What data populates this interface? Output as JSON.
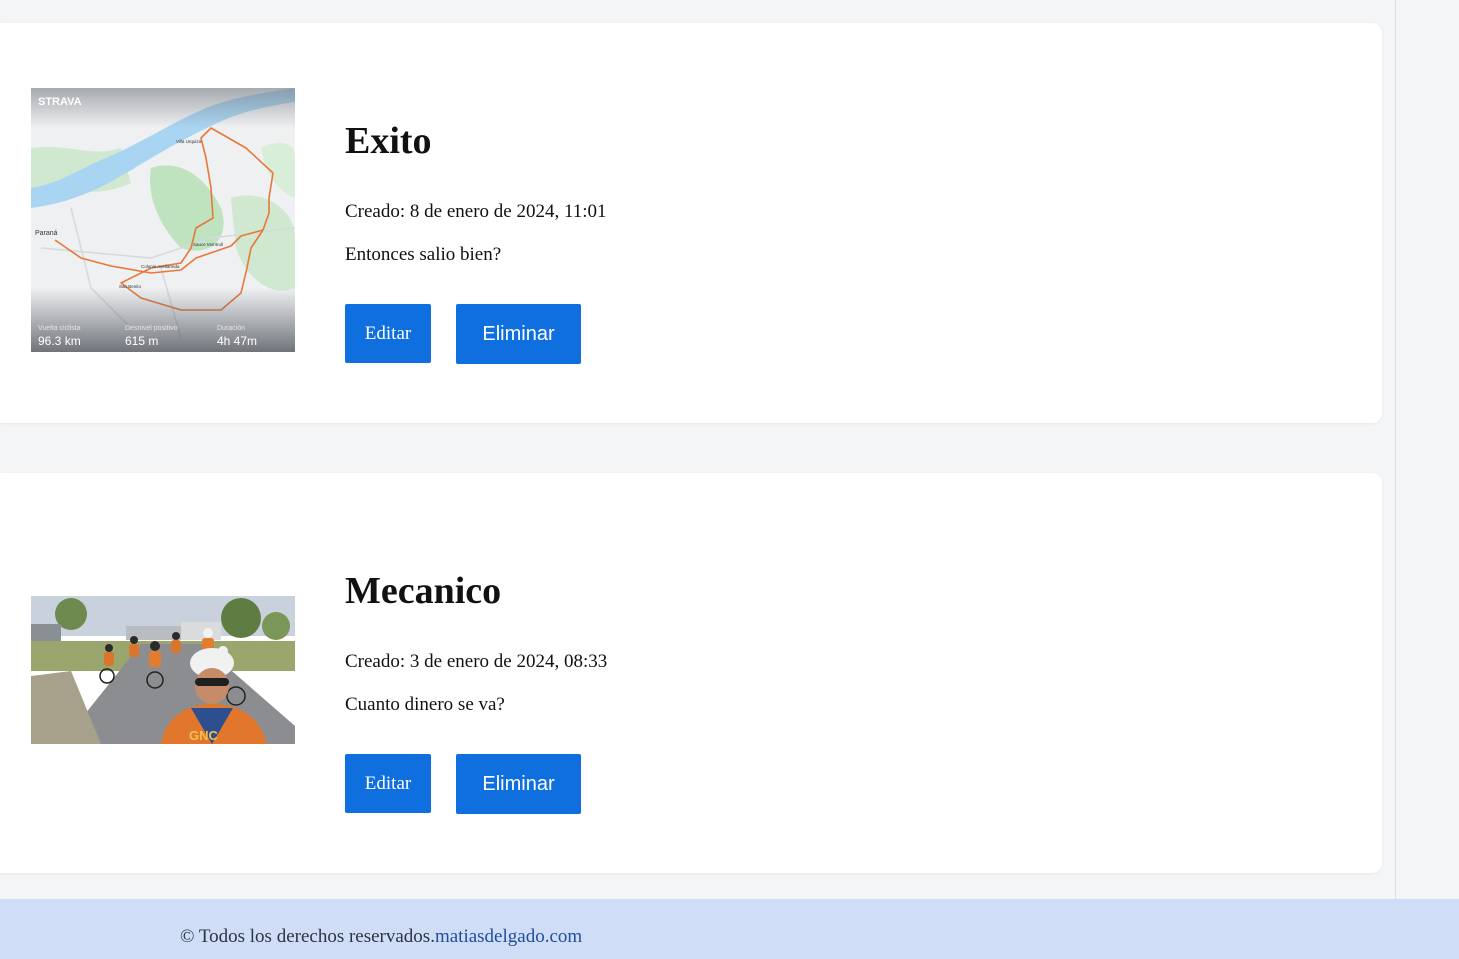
{
  "posts": [
    {
      "title": "Exito",
      "date": "Creado: 8 de enero de 2024, 11:01",
      "body": "Entonces salio bien?",
      "edit_label": "Editar",
      "delete_label": "Eliminar",
      "image": {
        "brand": "STRAVA",
        "places": [
          "Paraná",
          "Villa Urquiza",
          "Colonia Avellaneda",
          "Sauce Montrull",
          "San Benito"
        ],
        "stats": [
          {
            "label": "Vuelta ciclista",
            "value": "96.3 km"
          },
          {
            "label": "Desnivel positivo",
            "value": "615 m"
          },
          {
            "label": "Duración",
            "value": "4h 47m"
          }
        ]
      }
    },
    {
      "title": "Mecanico",
      "date": "Creado: 3 de enero de 2024, 08:33",
      "body": "Cuanto dinero se va?",
      "edit_label": "Editar",
      "delete_label": "Eliminar",
      "image": {
        "jersey_text": "GNC"
      }
    }
  ],
  "footer": {
    "text": "© Todos los derechos reservados.",
    "link": "matiasdelgado.com"
  },
  "colors": {
    "button": "#0f6fde",
    "footer_bg": "#d0ddf6",
    "page_bg": "#f4f5f7",
    "route": "#e8783a"
  }
}
